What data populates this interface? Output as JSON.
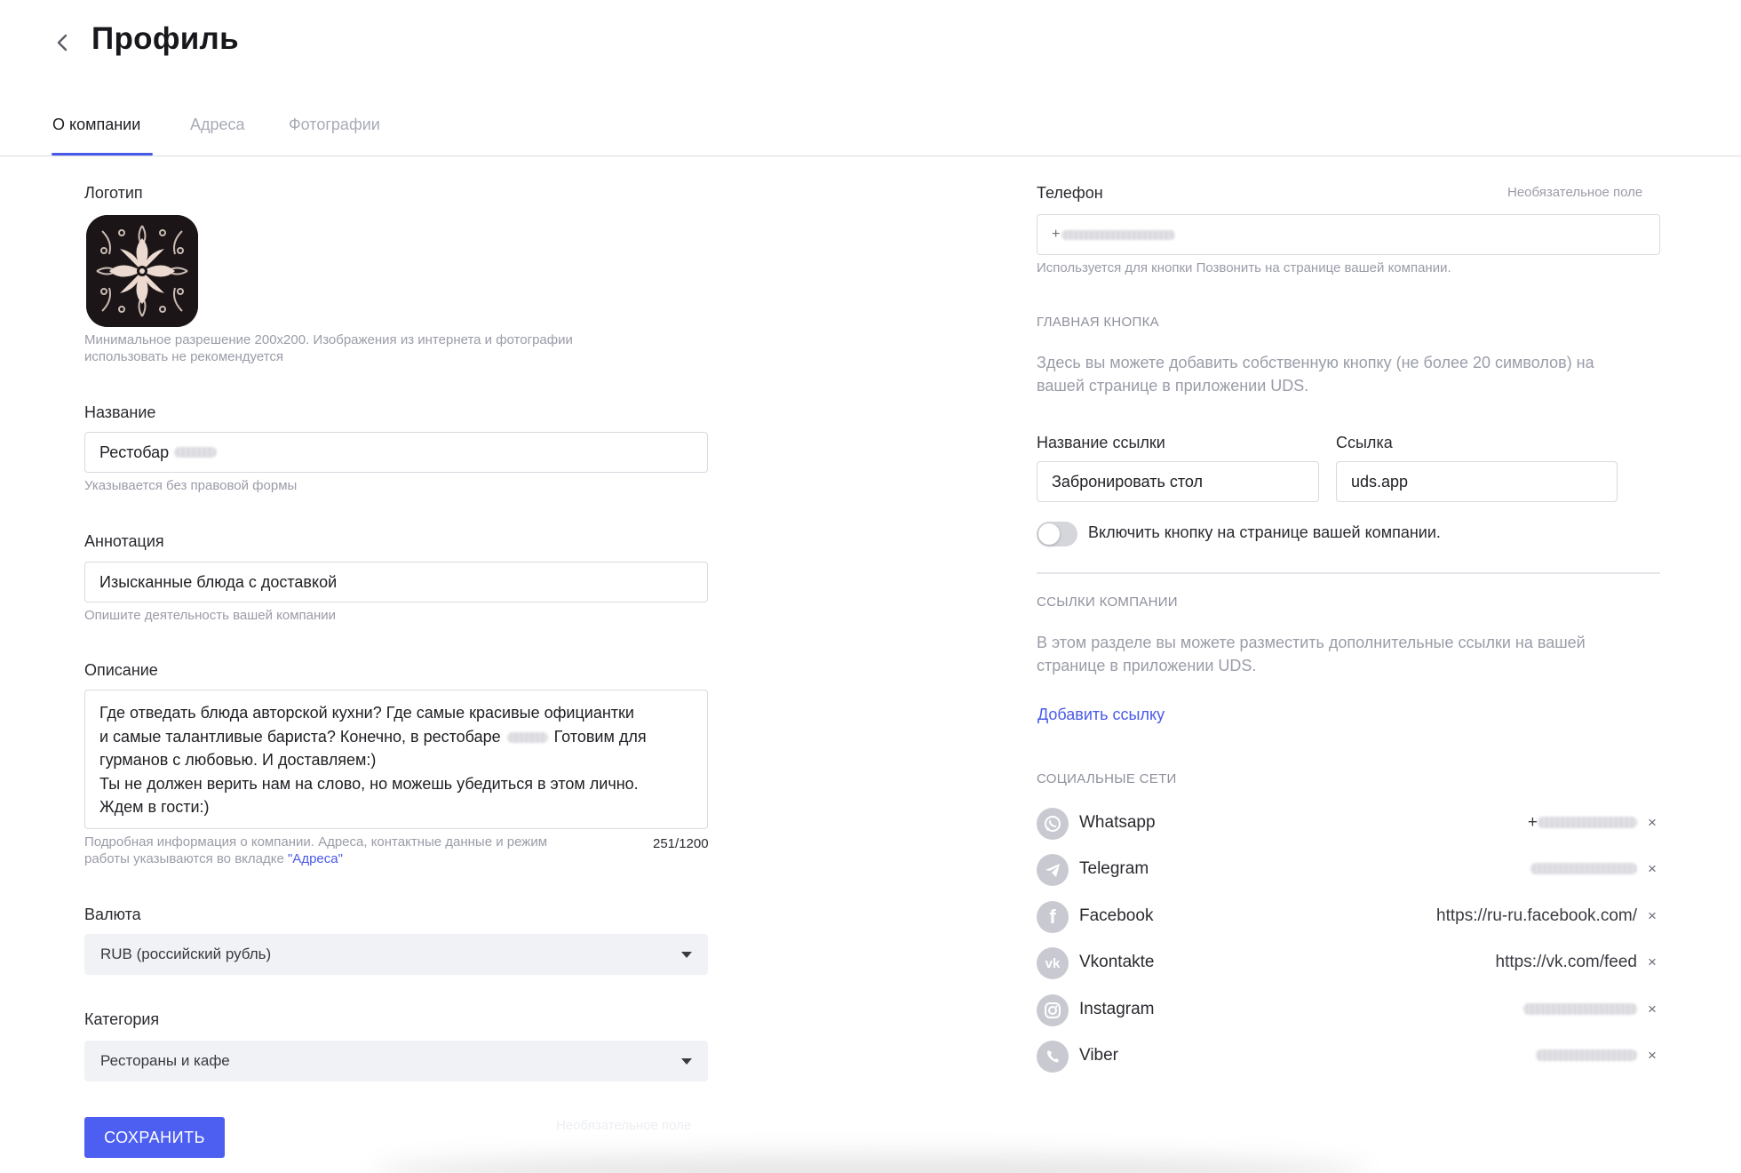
{
  "header": {
    "title": "Профиль"
  },
  "tabs": [
    {
      "label": "О компании"
    },
    {
      "label": "Адреса"
    },
    {
      "label": "Фотографии"
    }
  ],
  "left": {
    "logo": {
      "label": "Логотип",
      "hint_line1": "Минимальное разрешение 200х200. Изображения из интернета и фотографии",
      "hint_line2": "использовать не рекомендуется"
    },
    "name": {
      "label": "Название",
      "value": "Рестобар",
      "hint": "Указывается без правовой формы"
    },
    "annotation": {
      "label": "Аннотация",
      "value": "Изысканные блюда с доставкой",
      "hint": "Опишите деятельность вашей компании"
    },
    "description": {
      "label": "Описание",
      "line1": "Где отведать блюда авторской кухни? Где самые красивые официантки",
      "line2a": "и самые талантливые бариста? Конечно, в рестобаре",
      "line2b": "Готовим для",
      "line3": "гурманов с любовью. И доставляем:)",
      "line4": "Ты не должен верить нам на слово, но можешь убедиться в этом лично.",
      "line5": "Ждем в гости:)",
      "hint_line1": "Подробная информация о компании. Адреса, контактные данные и режим",
      "hint_line2_prefix": "работы указываются во вкладке ",
      "hint_link": "\"Адреса\"",
      "counter": "251/1200"
    },
    "currency": {
      "label": "Валюта",
      "value": "RUB (российский рубль)"
    },
    "category": {
      "label": "Категория",
      "value": "Рестораны и кафе"
    },
    "save_label": "СОХРАНИТЬ",
    "ghost_optional": "Необязательное поле"
  },
  "right": {
    "phone": {
      "label": "Телефон",
      "optional": "Необязательное поле",
      "value_prefix": "+",
      "hint": "Используется для кнопки Позвонить на странице вашей компании."
    },
    "main_button": {
      "caption": "ГЛАВНАЯ КНОПКА",
      "desc_line1": "Здесь вы можете добавить собственную кнопку (не более 20 символов) на",
      "desc_line2": "вашей странице в приложении UDS.",
      "link_name_label": "Название ссылки",
      "link_name_value": "Забронировать стол",
      "link_label": "Ссылка",
      "link_value": "uds.app",
      "toggle_label": "Включить кнопку на странице вашей компании.",
      "toggle_on": false
    },
    "company_links": {
      "caption": "ССЫЛКИ КОМПАНИИ",
      "desc_line1": "В этом разделе вы можете разместить дополнительные ссылки на вашей",
      "desc_line2": "странице в приложении UDS.",
      "add_link": "Добавить ссылку"
    },
    "socials": {
      "caption": "СОЦИАЛЬНЫЕ СЕТИ",
      "items": [
        {
          "name": "Whatsapp",
          "icon": "whatsapp-icon",
          "value": "+"
        },
        {
          "name": "Telegram",
          "icon": "telegram-icon",
          "value": ""
        },
        {
          "name": "Facebook",
          "icon": "facebook-icon",
          "value": "https://ru-ru.facebook.com/"
        },
        {
          "name": "Vkontakte",
          "icon": "vk-icon",
          "value": "https://vk.com/feed"
        },
        {
          "name": "Instagram",
          "icon": "instagram-icon",
          "value": ""
        },
        {
          "name": "Viber",
          "icon": "viber-icon",
          "value": ""
        }
      ]
    }
  },
  "colors": {
    "accent": "#4c5ff0",
    "link": "#4a5ae8",
    "muted": "#9a9ca8"
  }
}
